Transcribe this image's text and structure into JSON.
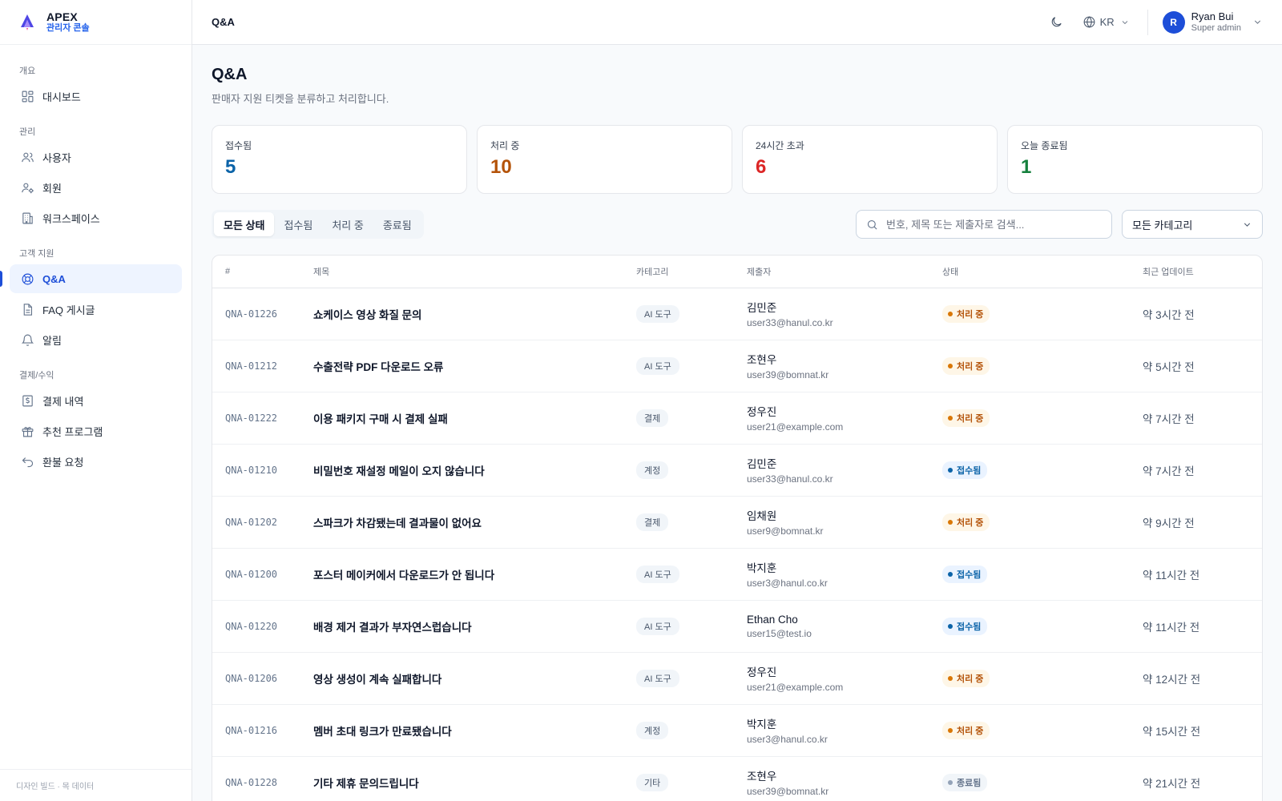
{
  "brand": {
    "name": "APEX",
    "subtitle": "관리자 콘솔",
    "accent": "#2563eb"
  },
  "sidebar": {
    "sections": [
      {
        "title": "개요",
        "items": [
          {
            "label": "대시보드",
            "icon": "dashboard-icon",
            "active": false
          }
        ]
      },
      {
        "title": "관리",
        "items": [
          {
            "label": "사용자",
            "icon": "users-icon",
            "active": false
          },
          {
            "label": "회원",
            "icon": "member-icon",
            "active": false
          },
          {
            "label": "워크스페이스",
            "icon": "building-icon",
            "active": false
          }
        ]
      },
      {
        "title": "고객 지원",
        "items": [
          {
            "label": "Q&A",
            "icon": "lifebuoy-icon",
            "active": true
          },
          {
            "label": "FAQ 게시글",
            "icon": "document-icon",
            "active": false
          },
          {
            "label": "알림",
            "icon": "bell-icon",
            "active": false
          }
        ]
      },
      {
        "title": "결제/수익",
        "items": [
          {
            "label": "결제 내역",
            "icon": "receipt-icon",
            "active": false
          },
          {
            "label": "추천 프로그램",
            "icon": "gift-icon",
            "active": false
          },
          {
            "label": "환불 요청",
            "icon": "undo-icon",
            "active": false
          }
        ]
      }
    ],
    "footer": "디자인 빌드 · 목 데이터"
  },
  "topbar": {
    "title": "Q&A",
    "language": "KR",
    "user": {
      "initial": "R",
      "name": "Ryan Bui",
      "role": "Super admin"
    }
  },
  "page": {
    "title": "Q&A",
    "subtitle": "판매자 지원 티켓을 분류하고 처리합니다."
  },
  "stats": [
    {
      "label": "접수됨",
      "value": "5",
      "color": "#0b63a8"
    },
    {
      "label": "처리 중",
      "value": "10",
      "color": "#b45309"
    },
    {
      "label": "24시간 초과",
      "value": "6",
      "color": "#dc2626"
    },
    {
      "label": "오늘 종료됨",
      "value": "1",
      "color": "#15803d"
    }
  ],
  "filters": {
    "tabs": [
      {
        "label": "모든 상태",
        "active": true
      },
      {
        "label": "접수됨",
        "active": false
      },
      {
        "label": "처리 중",
        "active": false
      },
      {
        "label": "종료됨",
        "active": false
      }
    ],
    "search_placeholder": "번호, 제목 또는 제출자로 검색...",
    "category_select": "모든 카테고리"
  },
  "table": {
    "columns": [
      "#",
      "제목",
      "카테고리",
      "제출자",
      "상태",
      "최근 업데이트"
    ],
    "rows": [
      {
        "id": "QNA-01226",
        "title": "쇼케이스 영상 화질 문의",
        "category": "AI 도구",
        "name": "김민준",
        "email": "user33@hanul.co.kr",
        "status": "처리 중",
        "status_type": "progress",
        "updated": "약 3시간 전"
      },
      {
        "id": "QNA-01212",
        "title": "수출전략 PDF 다운로드 오류",
        "category": "AI 도구",
        "name": "조현우",
        "email": "user39@bomnat.kr",
        "status": "처리 중",
        "status_type": "progress",
        "updated": "약 5시간 전"
      },
      {
        "id": "QNA-01222",
        "title": "이용 패키지 구매 시 결제 실패",
        "category": "결제",
        "name": "정우진",
        "email": "user21@example.com",
        "status": "처리 중",
        "status_type": "progress",
        "updated": "약 7시간 전"
      },
      {
        "id": "QNA-01210",
        "title": "비밀번호 재설정 메일이 오지 않습니다",
        "category": "계정",
        "name": "김민준",
        "email": "user33@hanul.co.kr",
        "status": "접수됨",
        "status_type": "received",
        "updated": "약 7시간 전"
      },
      {
        "id": "QNA-01202",
        "title": "스파크가 차감됐는데 결과물이 없어요",
        "category": "결제",
        "name": "임채원",
        "email": "user9@bomnat.kr",
        "status": "처리 중",
        "status_type": "progress",
        "updated": "약 9시간 전"
      },
      {
        "id": "QNA-01200",
        "title": "포스터 메이커에서 다운로드가 안 됩니다",
        "category": "AI 도구",
        "name": "박지훈",
        "email": "user3@hanul.co.kr",
        "status": "접수됨",
        "status_type": "received",
        "updated": "약 11시간 전"
      },
      {
        "id": "QNA-01220",
        "title": "배경 제거 결과가 부자연스럽습니다",
        "category": "AI 도구",
        "name": "Ethan Cho",
        "email": "user15@test.io",
        "status": "접수됨",
        "status_type": "received",
        "updated": "약 11시간 전"
      },
      {
        "id": "QNA-01206",
        "title": "영상 생성이 계속 실패합니다",
        "category": "AI 도구",
        "name": "정우진",
        "email": "user21@example.com",
        "status": "처리 중",
        "status_type": "progress",
        "updated": "약 12시간 전"
      },
      {
        "id": "QNA-01216",
        "title": "멤버 초대 링크가 만료됐습니다",
        "category": "계정",
        "name": "박지훈",
        "email": "user3@hanul.co.kr",
        "status": "처리 중",
        "status_type": "progress",
        "updated": "약 15시간 전"
      },
      {
        "id": "QNA-01228",
        "title": "기타 제휴 문의드립니다",
        "category": "기타",
        "name": "조현우",
        "email": "user39@bomnat.kr",
        "status": "종료됨",
        "status_type": "closed",
        "updated": "약 21시간 전"
      }
    ]
  }
}
